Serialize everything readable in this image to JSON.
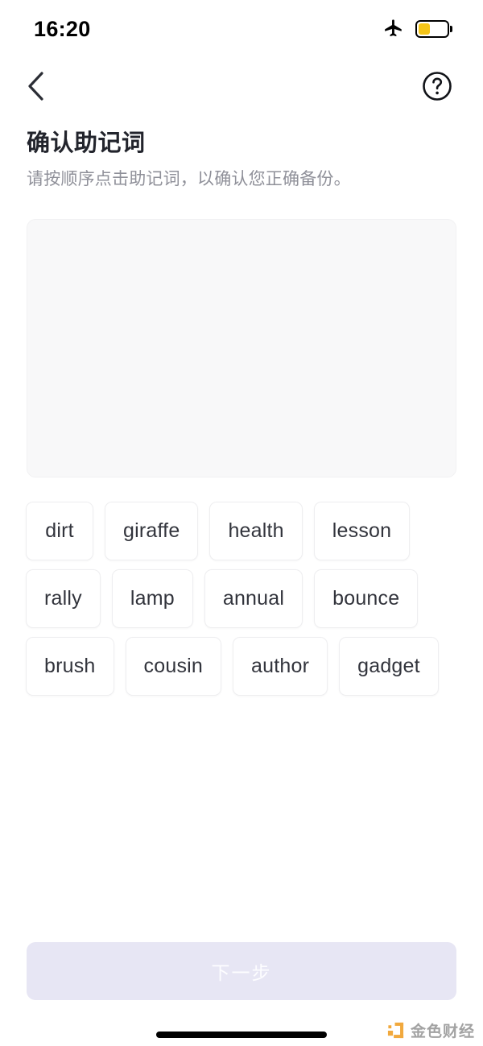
{
  "status_bar": {
    "time": "16:20",
    "airplane_icon": "airplane-mode-icon",
    "battery_icon": "battery-low-power-icon",
    "battery_level_percent": 38,
    "battery_fill_color": "#f5c518"
  },
  "nav_bar": {
    "back_icon": "chevron-left-icon",
    "help_icon": "question-mark-circle-icon"
  },
  "header": {
    "title": "确认助记词",
    "subtitle": "请按顺序点击助记词，以确认您正确备份。"
  },
  "answer_panel": {
    "selected_words": [],
    "background_color": "#f8f8f9"
  },
  "word_bank": {
    "words": [
      "dirt",
      "giraffe",
      "health",
      "lesson",
      "rally",
      "lamp",
      "annual",
      "bounce",
      "brush",
      "cousin",
      "author",
      "gadget"
    ]
  },
  "footer": {
    "next_label": "下一步",
    "next_disabled": true,
    "next_bg_color": "#e7e6f4",
    "next_text_color": "#fdfdff"
  },
  "watermark": {
    "text": "金色财经",
    "logo_color": "#f0a22e"
  }
}
